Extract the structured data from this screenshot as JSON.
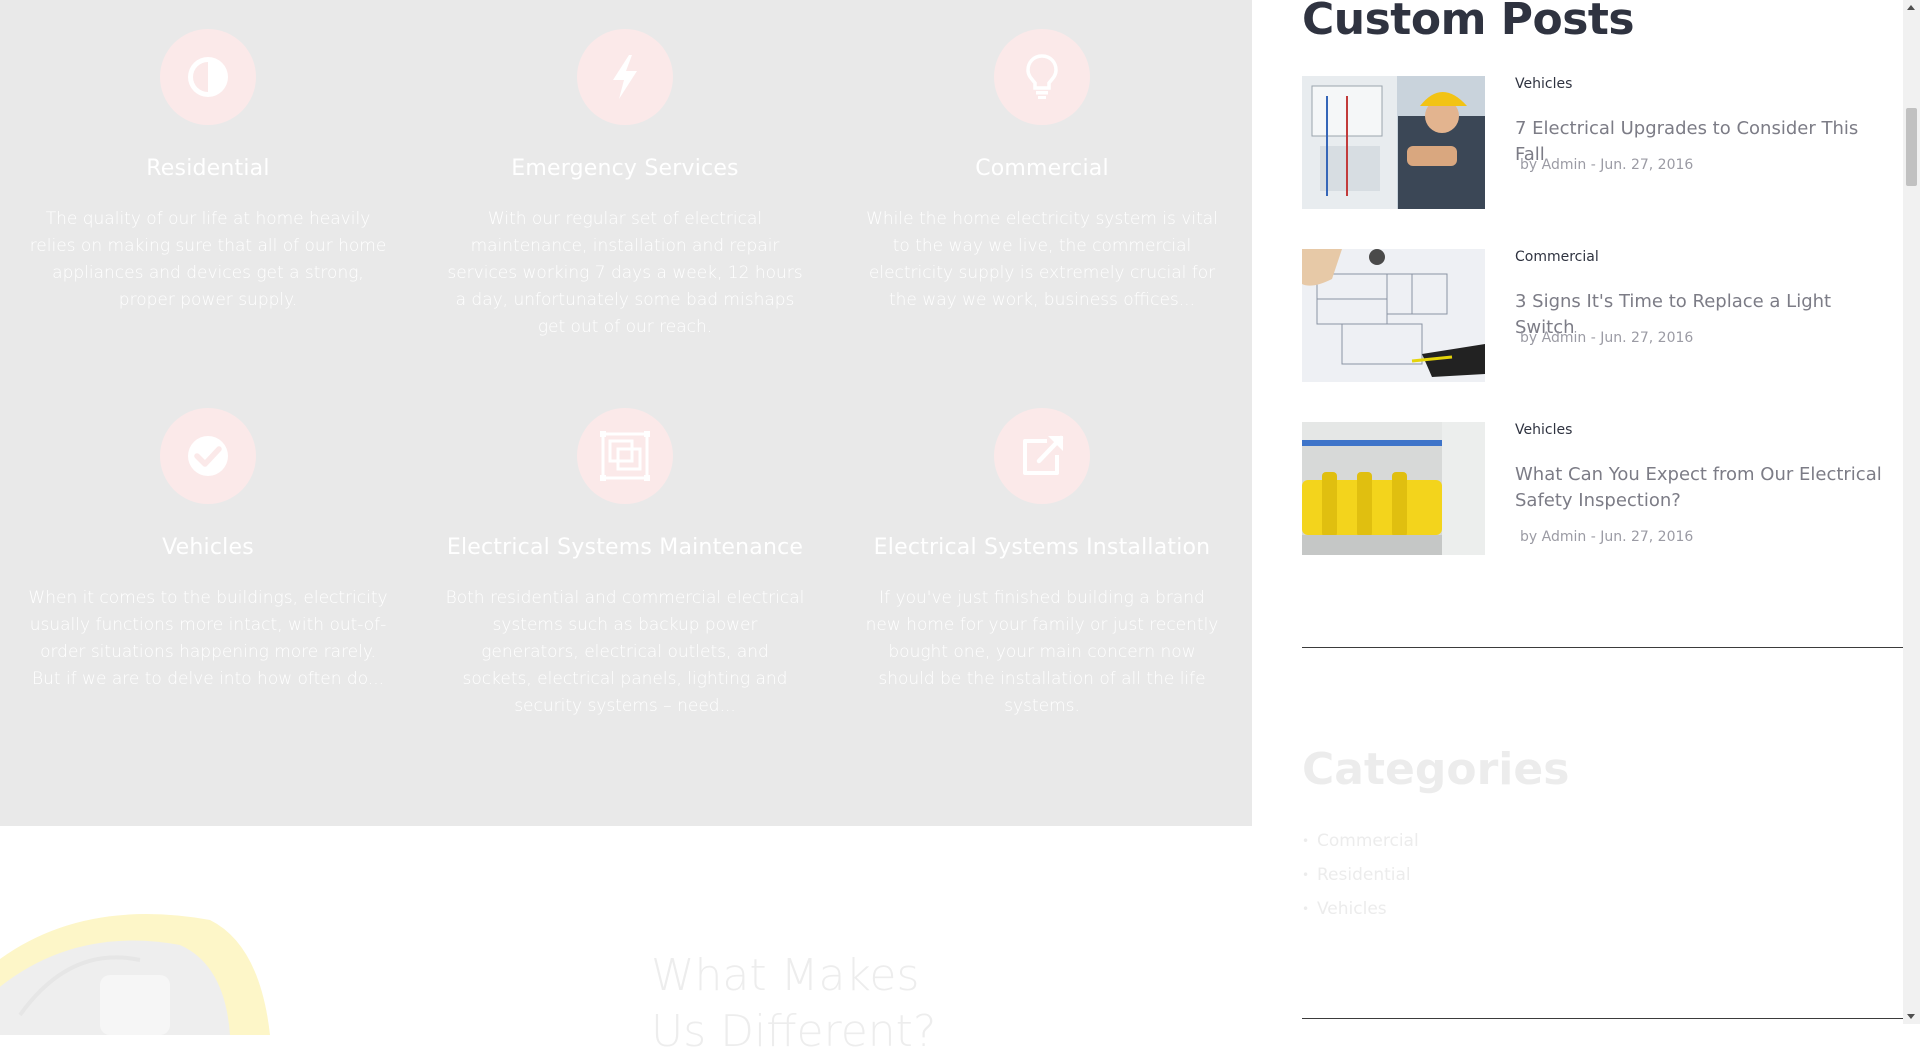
{
  "services": [
    {
      "title": "Residential",
      "icon": "contrast-icon",
      "desc": "The quality of our life at home heavily relies on making sure that all of our home appliances and devices get a strong, proper power supply."
    },
    {
      "title": "Emergency Services",
      "icon": "lightning-icon",
      "desc": "With our regular set of electrical maintenance, installation and repair services working 7 days a week, 12 hours a day, unfortunately some bad mishaps get out of our reach."
    },
    {
      "title": "Commercial",
      "icon": "lightbulb-icon",
      "desc": "While the home electricity system is vital to the way we live, the commercial electricity supply is extremely crucial for the way we work, business offices..."
    },
    {
      "title": "Vehicles",
      "icon": "checkmark-icon",
      "desc": "When it comes to the buildings, electricity usually functions more intact, with out-of-order situations happening more rarely. But if we are to delve into how often do..."
    },
    {
      "title": "Electrical Systems Maintenance",
      "icon": "layers-icon",
      "desc": "Both residential and commercial electrical systems such as backup power generators, electrical outlets, and sockets, electrical panels, lighting and security systems – need..."
    },
    {
      "title": "Electrical Systems Installation",
      "icon": "external-link-icon",
      "desc": "If you've just finished building a brand new home for your family or just recently bought one, your main concern now should be the installation of all the life systems."
    }
  ],
  "what_makes": {
    "line1": "What Makes",
    "line2": "Us Different?"
  },
  "sidebar": {
    "custom_posts_title": "Custom Posts",
    "posts": [
      {
        "category": "Vehicles",
        "title": "7 Electrical Upgrades to Consider This Fall",
        "meta": "by Admin - Jun. 27, 2016"
      },
      {
        "category": "Commercial",
        "title": "3 Signs It's Time to Replace a Light Switch",
        "meta": "by Admin - Jun. 27, 2016"
      },
      {
        "category": "Vehicles",
        "title": "What Can You Expect from Our Electrical Safety Inspection?",
        "meta": "by Admin - Jun. 27, 2016"
      }
    ],
    "categories_title": "Categories",
    "categories": [
      "Commercial",
      "Residential",
      "Vehicles"
    ]
  },
  "colors": {
    "accent_circle": "#fbe9e9",
    "heading_dark": "#2f3340",
    "panel_bg": "#e9e9e9"
  }
}
